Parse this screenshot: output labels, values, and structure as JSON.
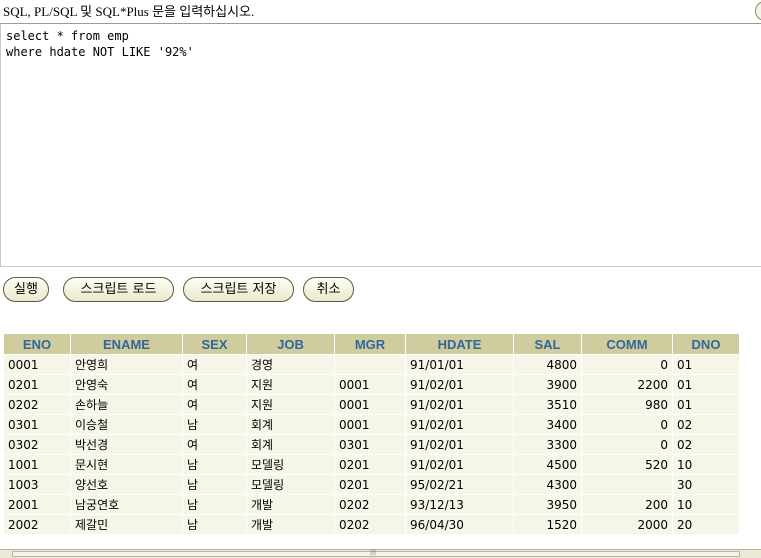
{
  "prompt": "SQL, PL/SQL 및 SQL*Plus 문을 입력하십시오.",
  "editor": {
    "text": "select * from emp\nwhere hdate NOT LIKE '92%'"
  },
  "buttons": {
    "run": "실행",
    "load": "스크립트 로드",
    "save": "스크립트 저장",
    "cancel": "취소"
  },
  "table": {
    "columns": [
      "ENO",
      "ENAME",
      "SEX",
      "JOB",
      "MGR",
      "HDATE",
      "SAL",
      "COMM",
      "DNO"
    ],
    "rows": [
      [
        "0001",
        "안영희",
        "여",
        "경영",
        "",
        "91/01/01",
        "4800",
        "0",
        "01"
      ],
      [
        "0201",
        "안영숙",
        "여",
        "지원",
        "0001",
        "91/02/01",
        "3900",
        "2200",
        "01"
      ],
      [
        "0202",
        "손하늘",
        "여",
        "지원",
        "0001",
        "91/02/01",
        "3510",
        "980",
        "01"
      ],
      [
        "0301",
        "이승철",
        "남",
        "회계",
        "0001",
        "91/02/01",
        "3400",
        "0",
        "02"
      ],
      [
        "0302",
        "박선경",
        "여",
        "회계",
        "0301",
        "91/02/01",
        "3300",
        "0",
        "02"
      ],
      [
        "1001",
        "문시현",
        "남",
        "모델링",
        "0201",
        "91/02/01",
        "4500",
        "520",
        "10"
      ],
      [
        "1003",
        "양선호",
        "남",
        "모델링",
        "0201",
        "95/02/21",
        "4300",
        "",
        "30"
      ],
      [
        "2001",
        "남궁연호",
        "남",
        "개발",
        "0202",
        "93/12/13",
        "3950",
        "200",
        "10"
      ],
      [
        "2002",
        "제갈민",
        "남",
        "개발",
        "0202",
        "96/04/30",
        "1520",
        "2000",
        "20"
      ]
    ]
  }
}
